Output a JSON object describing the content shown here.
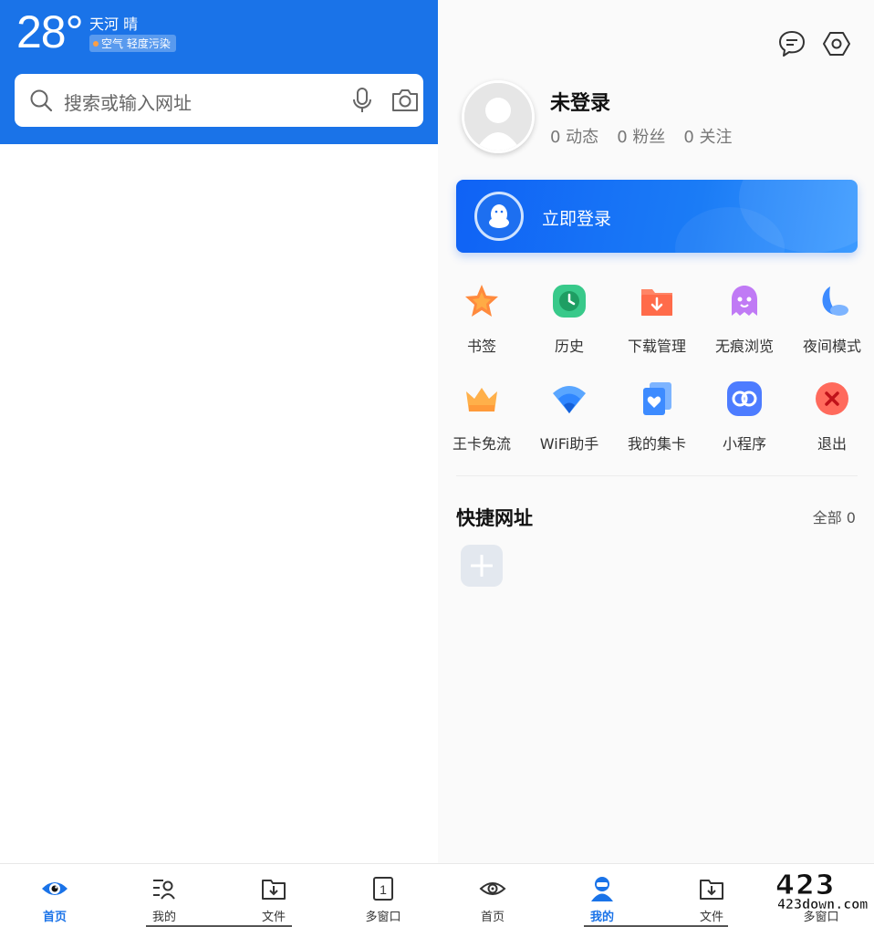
{
  "left": {
    "weather": {
      "temperature": "28°",
      "city_weather": "天河 晴",
      "air_quality": "空气 轻度污染"
    },
    "search": {
      "placeholder": "搜索或输入网址",
      "icons": [
        "search-icon",
        "microphone-icon",
        "camera-icon"
      ]
    },
    "nav": [
      {
        "label": "首页",
        "icon": "eye-icon",
        "active": true
      },
      {
        "label": "我的",
        "icon": "profile-list-icon",
        "active": false
      },
      {
        "label": "文件",
        "icon": "folder-download-icon",
        "active": false
      },
      {
        "label": "多窗口",
        "icon": "window-count-icon",
        "active": false,
        "badge": "1"
      }
    ]
  },
  "right": {
    "header_icons": [
      "message-icon",
      "settings-hexagon-icon"
    ],
    "profile": {
      "username": "未登录",
      "stats": [
        "0 动态",
        "0 粉丝",
        "0 关注"
      ]
    },
    "login_card": {
      "label": "立即登录",
      "icon": "qq-penguin-icon"
    },
    "grid": [
      [
        {
          "label": "书签",
          "icon": "star-icon",
          "color": "#ff8a3d"
        },
        {
          "label": "历史",
          "icon": "clock-icon",
          "color": "#2bb673"
        },
        {
          "label": "下载管理",
          "icon": "download-folder-icon",
          "color": "#ff6b4a"
        },
        {
          "label": "无痕浏览",
          "icon": "ghost-icon",
          "color": "#b562f0"
        },
        {
          "label": "夜间模式",
          "icon": "moon-icon",
          "color": "#3d8bff"
        }
      ],
      [
        {
          "label": "王卡免流",
          "icon": "crown-icon",
          "color": "#ffa53a"
        },
        {
          "label": "WiFi助手",
          "icon": "wifi-icon",
          "color": "#2f86ff"
        },
        {
          "label": "我的集卡",
          "icon": "heart-card-icon",
          "color": "#3d8bff"
        },
        {
          "label": "小程序",
          "icon": "mini-program-icon",
          "color": "#4d7cff"
        },
        {
          "label": "退出",
          "icon": "close-circle-icon",
          "color": "#f2473a"
        }
      ]
    ],
    "quick_links": {
      "title": "快捷网址",
      "all_label": "全部 0",
      "add_icon": "plus-icon"
    },
    "nav": [
      {
        "label": "首页",
        "icon": "eye-icon",
        "active": false
      },
      {
        "label": "我的",
        "icon": "person-icon",
        "active": true
      },
      {
        "label": "文件",
        "icon": "folder-download-icon",
        "active": false
      },
      {
        "label": "多窗口",
        "icon": "window-count-icon",
        "active": false
      }
    ]
  },
  "watermark": {
    "big": "423",
    "small": "423down.com"
  },
  "colors": {
    "brand_blue": "#1a73e8",
    "active_nav": "#1a73e8"
  }
}
